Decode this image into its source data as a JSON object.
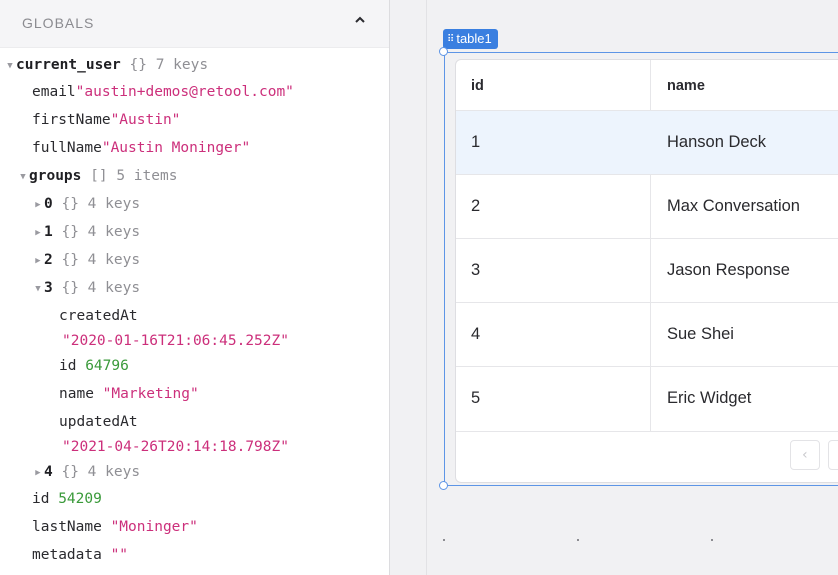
{
  "globals": {
    "title": "GLOBALS",
    "collapse_icon": "chevron-up-icon",
    "current_user": {
      "key": "current_user",
      "type": "{}",
      "count": "7 keys"
    },
    "email": {
      "key": "email",
      "value": "\"austin+demos@retool.com\""
    },
    "firstName": {
      "key": "firstName",
      "value": "\"Austin\""
    },
    "fullName": {
      "key": "fullName",
      "value": "\"Austin Moninger\""
    },
    "groups": {
      "key": "groups",
      "type": "[]",
      "count": "5 items"
    },
    "group_items": [
      {
        "index": "0",
        "type": "{}",
        "count": "4 keys"
      },
      {
        "index": "1",
        "type": "{}",
        "count": "4 keys"
      },
      {
        "index": "2",
        "type": "{}",
        "count": "4 keys"
      },
      {
        "index": "3",
        "type": "{}",
        "count": "4 keys"
      },
      {
        "index": "4",
        "type": "{}",
        "count": "4 keys"
      }
    ],
    "group3": {
      "createdAt_key": "createdAt",
      "createdAt_value": "\"2020-01-16T21:06:45.252Z\"",
      "id_key": "id",
      "id_value": "64796",
      "name_key": "name",
      "name_value": "\"Marketing\"",
      "updatedAt_key": "updatedAt",
      "updatedAt_value": "\"2021-04-26T20:14:18.798Z\""
    },
    "id": {
      "key": "id",
      "value": "54209"
    },
    "lastName": {
      "key": "lastName",
      "value": "\"Moninger\""
    },
    "metadata": {
      "key": "metadata",
      "value": "\"\""
    }
  },
  "component": {
    "tag_label": "table1",
    "grip_icon": "drag-grip-icon"
  },
  "table": {
    "columns": [
      "id",
      "name"
    ],
    "rows": [
      {
        "id": "1",
        "name": "Hanson Deck"
      },
      {
        "id": "2",
        "name": "Max Conversation"
      },
      {
        "id": "3",
        "name": "Jason Response"
      },
      {
        "id": "4",
        "name": "Sue Shei"
      },
      {
        "id": "5",
        "name": "Eric Widget"
      }
    ],
    "selected_row": 0,
    "colors": {
      "selected_row_bg": "#edf4fd",
      "accent": "#3a7fe0"
    },
    "pager": {
      "prev_icon": "chevron-left-icon"
    }
  }
}
